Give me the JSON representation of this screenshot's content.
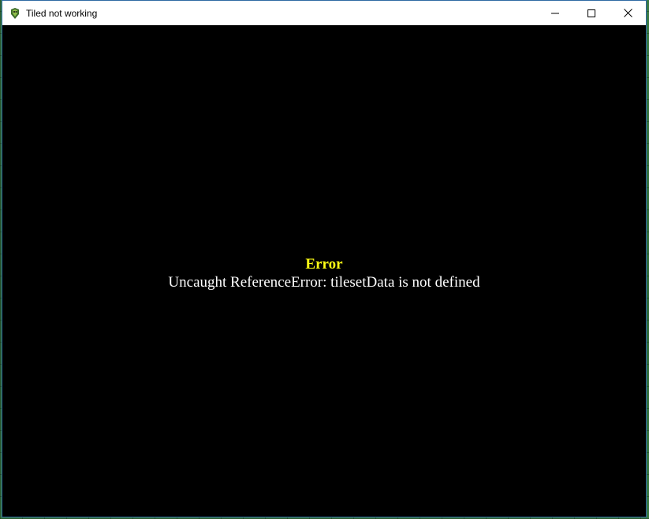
{
  "window": {
    "title": "Tiled not working",
    "controls": {
      "minimize": "minimize-icon",
      "maximize": "maximize-icon",
      "close": "close-icon"
    }
  },
  "error": {
    "title": "Error",
    "message": "Uncaught ReferenceError: tilesetData is not defined",
    "title_color": "#ffff14",
    "message_color": "#ffffff"
  },
  "colors": {
    "content_background": "#000000",
    "titlebar_background": "#ffffff"
  }
}
